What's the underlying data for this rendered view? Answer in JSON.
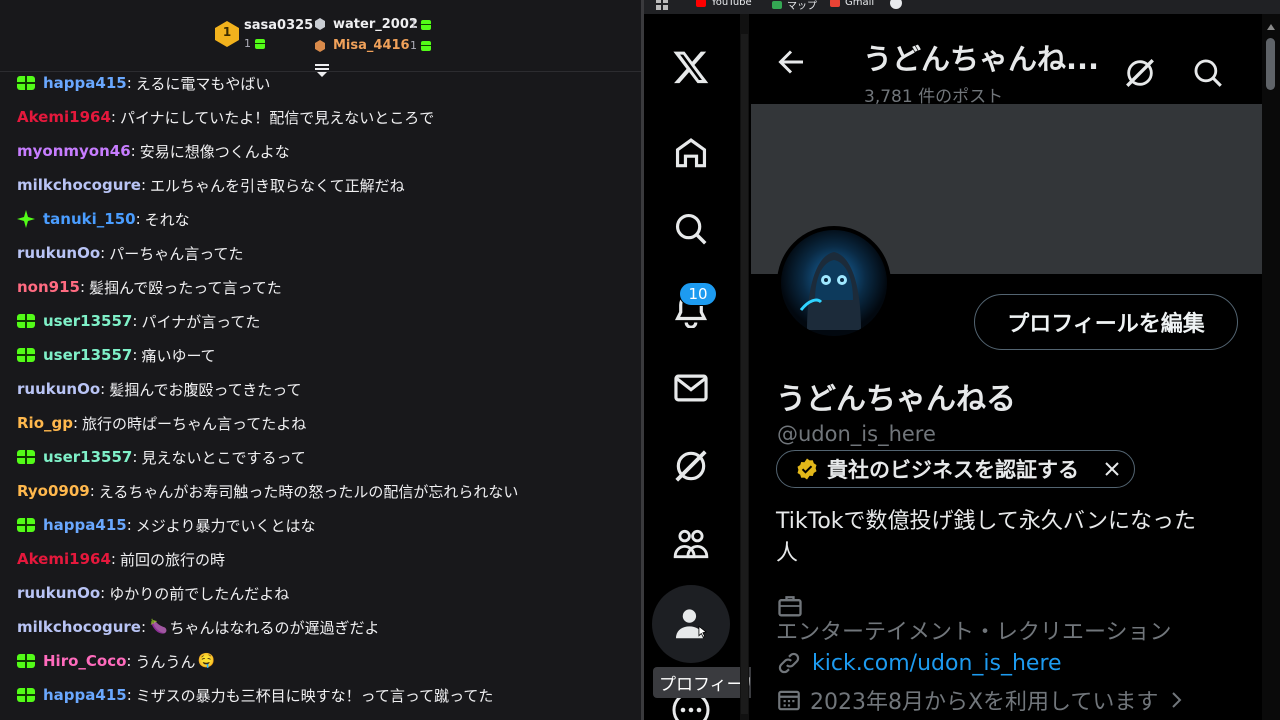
{
  "chat": {
    "leaderboard": {
      "first": {
        "rank": "1",
        "name": "sasa0325",
        "count": "1"
      },
      "second": {
        "name": "water_2002",
        "count": "1"
      },
      "third": {
        "name": "Misa_4416",
        "count": "1"
      }
    },
    "messages": [
      {
        "user": "happa415",
        "text": "えるに電マもやばい",
        "color": "#6aa8ff",
        "badge": "sub"
      },
      {
        "user": "Akemi1964",
        "text": "パイナにしていたよ！配信で見えないところで",
        "color": "#e5183c",
        "badge": ""
      },
      {
        "user": "myonmyon46",
        "text": "安易に想像つくんよな",
        "color": "#c77dff",
        "badge": ""
      },
      {
        "user": "milkchocogure",
        "text": "エルちゃんを引き取らなくて正解だね",
        "color": "#b9c4f5",
        "badge": ""
      },
      {
        "user": "tanuki_150",
        "text": "それな",
        "color": "#4a9dff",
        "badge": "star"
      },
      {
        "user": "ruukunOo",
        "text": "パーちゃん言ってた",
        "color": "#b9c4f5",
        "badge": ""
      },
      {
        "user": "non915",
        "text": "髪掴んで殴ったって言ってた",
        "color": "#ff6b81",
        "badge": ""
      },
      {
        "user": "user13557",
        "text": "パイナが言ってた",
        "color": "#7ff0c8",
        "badge": "sub"
      },
      {
        "user": "user13557",
        "text": "痛いゆーて",
        "color": "#7ff0c8",
        "badge": "sub"
      },
      {
        "user": "ruukunOo",
        "text": "髪掴んでお腹殴ってきたって",
        "color": "#b9c4f5",
        "badge": ""
      },
      {
        "user": "Rio_gp",
        "text": "旅行の時ぱーちゃん言ってたよね",
        "color": "#ffb84d",
        "badge": ""
      },
      {
        "user": "user13557",
        "text": "見えないとこでするって",
        "color": "#7ff0c8",
        "badge": "sub"
      },
      {
        "user": "Ryo0909",
        "text": "えるちゃんがお寿司触った時の怒ったルの配信が忘れられない",
        "color": "#ffb84d",
        "badge": ""
      },
      {
        "user": "happa415",
        "text": "メジより暴力でいくとはな",
        "color": "#6aa8ff",
        "badge": "sub"
      },
      {
        "user": "Akemi1964",
        "text": "前回の旅行の時",
        "color": "#e5183c",
        "badge": ""
      },
      {
        "user": "ruukunOo",
        "text": "ゆかりの前でしたんだよね",
        "color": "#b9c4f5",
        "badge": ""
      },
      {
        "user": "milkchocogure",
        "text": "ちゃんはなれるのが遅過ぎだよ",
        "color": "#b9c4f5",
        "badge": "",
        "emote": "🍆"
      },
      {
        "user": "Hiro_Coco",
        "text": "うんうん",
        "color": "#ff6bbd",
        "badge": "sub",
        "emoteAfter": "🤤"
      },
      {
        "user": "happa415",
        "text": "ミザスの暴力も三杯目に映すな！って言って蹴ってた",
        "color": "#6aa8ff",
        "badge": "sub"
      }
    ]
  },
  "bookmarks": [
    {
      "label": "YouTube",
      "color": "#ff0000"
    },
    {
      "label": "マップ",
      "color": "#34a853"
    },
    {
      "label": "Gmail",
      "color": "#ea4335"
    }
  ],
  "nav": {
    "notifications_count": "10",
    "tooltip": "プロフィール"
  },
  "profile": {
    "header_name": "うどんちゃんね...",
    "post_count": "3,781 件のポスト",
    "edit_button": "プロフィールを編集",
    "display_name": "うどんちゃんねる",
    "handle": "@udon_is_here",
    "verify_cta": "貴社のビジネスを認証する",
    "bio": "TikTokで数億投げ銭して永久バンになった人",
    "category": "エンターテイメント・レクリエーション",
    "link": "kick.com/udon_is_here",
    "joined": "2023年8月からXを利用しています"
  },
  "colors": {
    "accent": "#1d9bf0",
    "kick_green": "#53fc18",
    "chat_bg": "#18181b",
    "x_bg": "#000000"
  }
}
